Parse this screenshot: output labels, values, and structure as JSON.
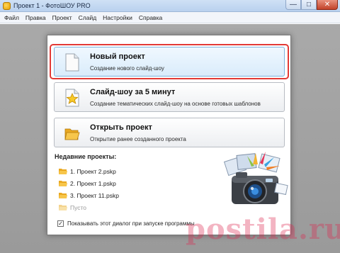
{
  "window": {
    "title": "Проект 1 - ФотоШОУ PRO",
    "controls": {
      "minimize": "—",
      "maximize": "□",
      "close": "✕"
    }
  },
  "menu": {
    "items": [
      "Файл",
      "Правка",
      "Проект",
      "Слайд",
      "Настройки",
      "Справка"
    ]
  },
  "dialog": {
    "actions": [
      {
        "title": "Новый проект",
        "subtitle": "Создание нового слайд-шоу",
        "icon": "blank-document-icon",
        "selected": true
      },
      {
        "title": "Слайд-шоу за 5 минут",
        "subtitle": "Создание тематических слайд-шоу на основе готовых шаблонов",
        "icon": "star-document-icon",
        "selected": false
      },
      {
        "title": "Открыть проект",
        "subtitle": "Открытие ранее созданного проекта",
        "icon": "open-folder-icon",
        "selected": false
      }
    ],
    "recent": {
      "heading": "Недавние проекты:",
      "items": [
        "1. Проект 2.pskp",
        "2. Проект 1.pskp",
        "3. Проект 11.pskp"
      ],
      "empty_label": "Пусто"
    },
    "startup_checkbox": {
      "label": "Показывать этот диалог при запуске программы",
      "checked": true
    }
  },
  "watermark": "postila.ru",
  "colors": {
    "selection_ring": "#e23a36",
    "title_bar": "#b9d1ee",
    "folder": "#f2b431",
    "workspace": "#a0a0a0"
  }
}
